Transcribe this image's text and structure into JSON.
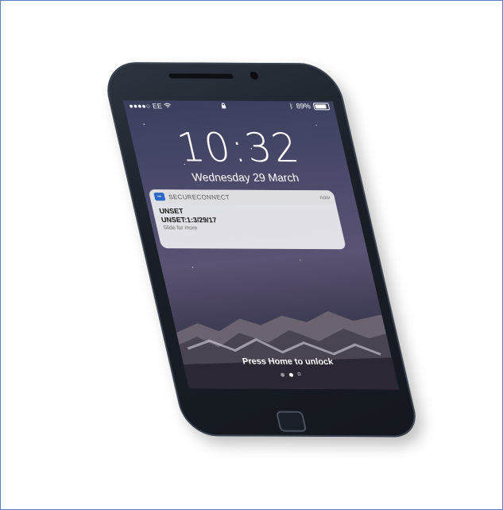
{
  "status_bar": {
    "signal": "●●●●○",
    "carrier": "EE",
    "wifi_icon": "wifi-icon",
    "lock_icon": "lock-icon",
    "bluetooth_icon": "bluetooth-icon",
    "battery_percent": "89%",
    "battery_level": 0.89
  },
  "lock_screen": {
    "time": "10:32",
    "date": "Wednesday 29 March",
    "unlock_hint": "Press Home to unlock"
  },
  "notification": {
    "app_name": "SECURECONNECT",
    "time": "now",
    "title": "UNSET",
    "message": "UNSET:1:3/29/17",
    "hint": "Slide for more"
  },
  "page_dots": {
    "count": 2,
    "active_index": 1,
    "camera_icon": "camera-icon"
  },
  "colors": {
    "frame_border": "#5a7fc4",
    "app_icon": "#2a68c8",
    "phone_body": "#1a1f27"
  }
}
